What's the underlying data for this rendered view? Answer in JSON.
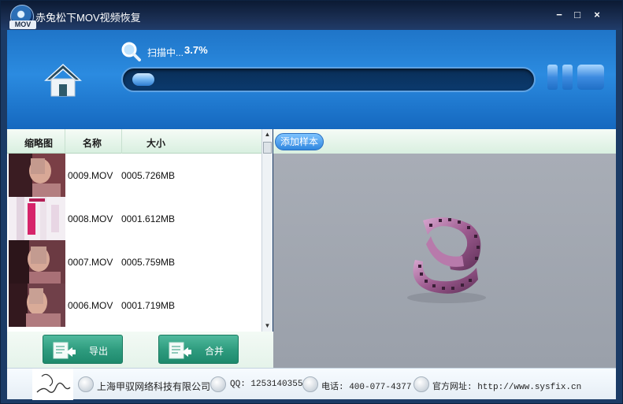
{
  "window": {
    "title": "赤兔松下MOV视频恢复",
    "logo_text": "MOV"
  },
  "controls": {
    "minimize": "−",
    "maximize": "□",
    "close": "×"
  },
  "scan": {
    "status_label": "扫描中...",
    "percent_text": "3.7%",
    "progress_fraction": 0.037
  },
  "list": {
    "columns": [
      "缩略图",
      "名称",
      "大小"
    ],
    "rows": [
      {
        "name": "0009.MOV",
        "size": "0005.726MB"
      },
      {
        "name": "0008.MOV",
        "size": "0001.612MB"
      },
      {
        "name": "0007.MOV",
        "size": "0005.759MB"
      },
      {
        "name": "0006.MOV",
        "size": "0001.719MB"
      }
    ]
  },
  "buttons": {
    "export": "导出",
    "merge": "合并",
    "add_sample": "添加样本"
  },
  "footer": {
    "company": "上海甲驭网络科技有限公司",
    "qq": "QQ: 1253140355",
    "phone": "电话: 400-077-4377",
    "website": "官方网址: http://www.sysfix.cn"
  },
  "colors": {
    "header_blue": "#2b8be0",
    "button_green": "#2d9a7d",
    "preview_gray": "#a3a8b1"
  }
}
